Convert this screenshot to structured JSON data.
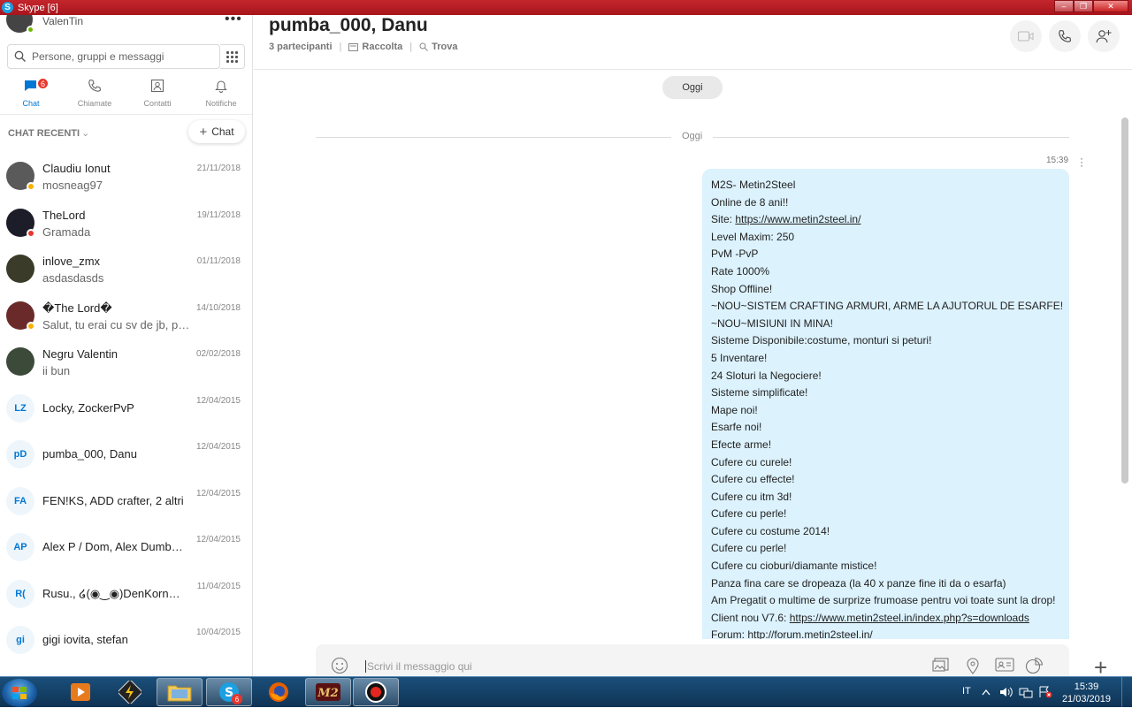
{
  "window": {
    "title": "Skype [6]",
    "app_icon_letter": "S"
  },
  "profile": {
    "name": "ValenTin"
  },
  "search": {
    "placeholder": "Persone, gruppi e messaggi"
  },
  "nav": {
    "chat": {
      "label": "Chat",
      "badge": "6"
    },
    "calls": {
      "label": "Chiamate"
    },
    "contacts": {
      "label": "Contatti"
    },
    "notifications": {
      "label": "Notifiche"
    }
  },
  "recent": {
    "header": "CHAT RECENTI",
    "new_chat_label": "Chat"
  },
  "chats": [
    {
      "name": "Claudiu Ionut",
      "message": "mosneag97",
      "date": "21/11/2018",
      "avatar_color": "#5a5a5a",
      "status_color": "#f8b100"
    },
    {
      "name": "TheLord",
      "message": "Gramada",
      "date": "19/11/2018",
      "avatar_color": "#1d1d2a",
      "status_color": "#e8362c"
    },
    {
      "name": "inlove_zmx",
      "message": "asdasdasds",
      "date": "01/11/2018",
      "avatar_color": "#3b3b2a"
    },
    {
      "name": "�The Lord�",
      "message": "Salut, tu erai cu sv de jb, pa...",
      "date": "14/10/2018",
      "avatar_color": "#6b2a2a",
      "status_color": "#f8b100"
    },
    {
      "name": "Negru Valentin",
      "message": "ii bun",
      "date": "02/02/2018",
      "avatar_color": "#3c4a3a"
    },
    {
      "name": "Locky, ZockerPvP",
      "date": "12/04/2015",
      "initials": "LZ"
    },
    {
      "name": "pumba_000, Danu",
      "date": "12/04/2015",
      "initials": "pD"
    },
    {
      "name": "FEN!KS, ADD crafter, 2 altri",
      "date": "12/04/2015",
      "initials": "FA"
    },
    {
      "name": "Alex P / Dom, Alex Dumbrav...",
      "date": "12/04/2015",
      "initials": "AP"
    },
    {
      "name": "Rusu., ໒(◉‿◉)DenKorner#Yo...",
      "date": "11/04/2015",
      "initials": "R("
    },
    {
      "name": "gigi iovita, stefan",
      "date": "10/04/2015",
      "initials": "gi"
    }
  ],
  "conversation": {
    "title": "pumba_000, Danu",
    "participants": "3 partecipanti",
    "gallery": "Raccolta",
    "find": "Trova",
    "day_pill": "Oggi",
    "day_separator": "Oggi",
    "message_time": "15:39",
    "message_lines": [
      "M2S- Metin2Steel",
      "Online de 8 ani!!",
      "Site: ",
      "Level Maxim: 250",
      "PvM -PvP",
      "Rate 1000%",
      "Shop Offline!",
      "~NOU~SISTEM CRAFTING ARMURI, ARME LA AJUTORUL DE ESARFE!",
      "~NOU~MISIUNI IN MINA!",
      "Sisteme Disponibile:costume, monturi si peturi!",
      "5 Inventare!",
      "24 Sloturi la Negociere!",
      "Sisteme simplificate!",
      "Mape noi!",
      "Esarfe noi!",
      "Efecte arme!",
      "Cufere cu curele!",
      "Cufere cu effecte!",
      "Cufere cu itm 3d!",
      "Cufere cu perle!",
      "Cufere cu costume 2014!",
      "Cufere cu perle!",
      "Cufere cu cioburi/diamante mistice!",
      "Panza fina care se dropeaza (la 40 x panze fine iti da o esarfa)",
      "Am Pregatit o multime de surprize frumoase pentru voi toate sunt la drop!",
      "Client nou V7.6: ",
      "Forum: http://forum.metin2steel.in/"
    ],
    "site_link": "https://www.metin2steel.in/",
    "client_link": "https://www.metin2steel.in/index.php?s=downloads",
    "composer_placeholder": "Scrivi il messaggio qui"
  },
  "taskbar": {
    "language": "IT",
    "time": "15:39",
    "date": "21/03/2019",
    "skype_badge": "6",
    "colors": {
      "start": "#1b5fa6",
      "taskbar": "#0f3354"
    }
  },
  "colors": {
    "accent": "#0078d4",
    "bubble": "#dcf2fd",
    "titlebar": "#c4262d"
  }
}
